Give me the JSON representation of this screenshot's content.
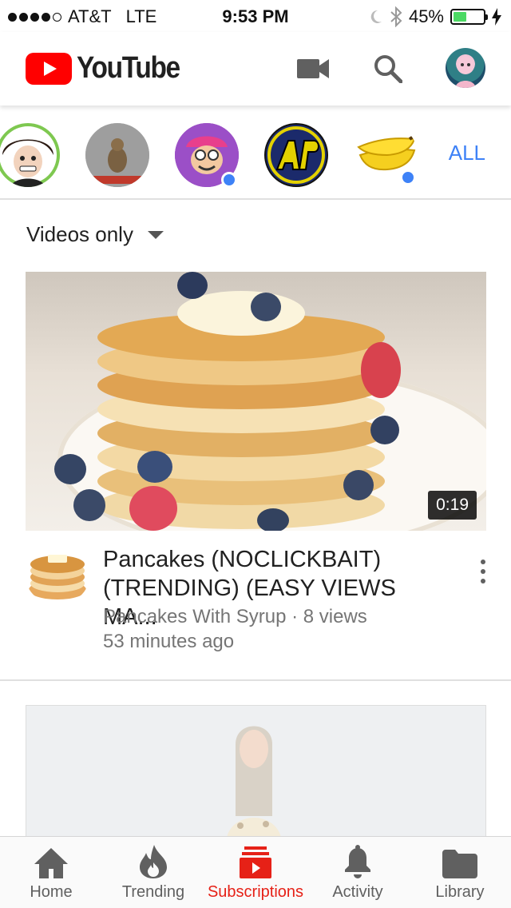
{
  "status_bar": {
    "carrier": "AT&T",
    "network": "LTE",
    "time": "9:53 PM",
    "battery": "45%",
    "battery_level": 0.45
  },
  "header": {
    "logo_text": "YouTube",
    "icons": [
      "video-camera-icon",
      "search-icon",
      "account-avatar"
    ]
  },
  "channels": {
    "all_label": "ALL",
    "items": [
      {
        "name": "channel-1",
        "new": false
      },
      {
        "name": "channel-2",
        "new": false
      },
      {
        "name": "channel-3",
        "new": true
      },
      {
        "name": "channel-4",
        "new": false
      },
      {
        "name": "channel-5",
        "new": true
      }
    ]
  },
  "filter": {
    "label": "Videos only"
  },
  "videos": [
    {
      "title": "Pancakes (NOCLICKBAIT) (TRENDING) (EASY VIEWS MA...",
      "channel": "Pancakes With Syrup",
      "views": "8 views",
      "age": "53 minutes ago",
      "duration": "0:19"
    }
  ],
  "bottom_nav": {
    "items": [
      {
        "label": "Home",
        "icon": "home-icon"
      },
      {
        "label": "Trending",
        "icon": "flame-icon"
      },
      {
        "label": "Subscriptions",
        "icon": "subscriptions-icon",
        "active": true
      },
      {
        "label": "Activity",
        "icon": "bell-icon"
      },
      {
        "label": "Library",
        "icon": "folder-icon"
      }
    ]
  },
  "colors": {
    "brand_red": "#ff0000",
    "active_red": "#e62117",
    "accent_blue": "#3e82f7",
    "battery_green": "#4cd964"
  }
}
